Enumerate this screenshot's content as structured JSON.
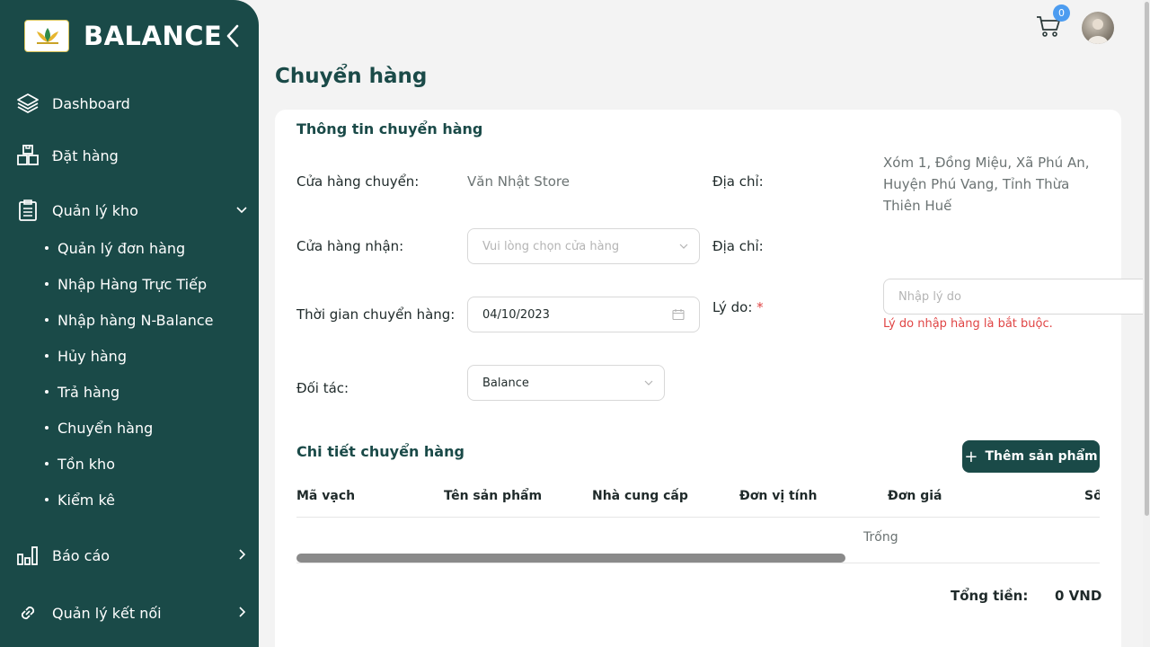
{
  "sidebar": {
    "brand": "BALANCE",
    "items": [
      {
        "label": "Dashboard"
      },
      {
        "label": "Đặt hàng"
      },
      {
        "label": "Quản lý kho"
      },
      {
        "label": "Báo cáo"
      },
      {
        "label": "Quản lý kết nối"
      }
    ],
    "subitems": [
      "Quản lý đơn hàng",
      "Nhập Hàng Trực Tiếp",
      "Nhập hàng N-Balance",
      "Hủy hàng",
      "Trả hàng",
      "Chuyển hàng",
      "Tồn kho",
      "Kiểm kê"
    ]
  },
  "header": {
    "cart_count": "0"
  },
  "page": {
    "title": "Chuyển hàng"
  },
  "info": {
    "title": "Thông tin chuyển hàng",
    "from_store_label": "Cửa hàng chuyển:",
    "from_store_value": "Văn Nhật Store",
    "address_label": "Địa chỉ:",
    "from_address": "Xóm 1, Đồng Miệu, Xã Phú An, Huyện Phú Vang, Tỉnh Thừa Thiên Huế",
    "to_store_label": "Cửa hàng nhận:",
    "to_store_placeholder": "Vui lòng chọn cửa hàng",
    "to_address_label": "Địa chỉ:",
    "time_label": "Thời gian chuyển hàng:",
    "time_value": "04/10/2023",
    "reason_label": "Lý do:",
    "reason_required_mark": "*",
    "reason_placeholder": "Nhập lý do",
    "reason_error": "Lý do nhập hàng là bắt buộc.",
    "partner_label": "Đối tác:",
    "partner_value": "Balance"
  },
  "details": {
    "title": "Chi tiết chuyển hàng",
    "add_button": "Thêm sản phẩm",
    "columns": [
      "Mã vạch",
      "Tên sản phẩm",
      "Nhà cung cấp",
      "Đơn vị tính",
      "Đơn giá",
      "Số"
    ],
    "empty_text": "Trống",
    "total_label": "Tổng tiền:",
    "total_value": "0 VND"
  },
  "colors": {
    "primary": "#1a4a48",
    "error": "#e04545",
    "badge": "#4c9cf0"
  }
}
